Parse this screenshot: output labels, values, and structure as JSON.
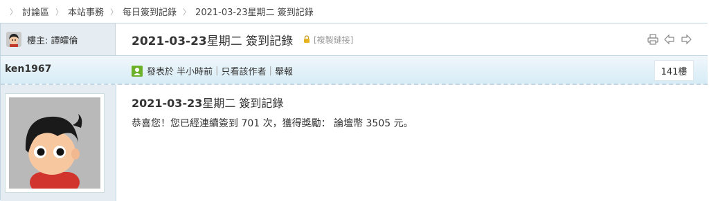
{
  "breadcrumb": {
    "items": [
      "討論區",
      "本站事務",
      "每日簽到記錄",
      "2021-03-23星期二 簽到記錄"
    ]
  },
  "thread": {
    "op_label": "樓主: 譚皬倫",
    "title_date": "2021-03-23",
    "title_rest": "星期二 簽到記錄",
    "copy_link": "[複製鏈接]"
  },
  "post": {
    "username": "ken1967",
    "posted_at": "發表於 半小時前",
    "only_author": "只看該作者",
    "report": "舉報",
    "floor": "141樓",
    "title_date": "2021-03-23",
    "title_rest": "星期二 簽到記錄",
    "body": "恭喜您！您已經連續簽到 701 次，獲得獎勵： 論壇幣 3505 元。"
  },
  "icons": {
    "print": "print-icon",
    "prev": "prev-thread-icon",
    "next": "next-thread-icon",
    "lock": "lock-icon",
    "meta": "user-online-icon"
  },
  "colors": {
    "border": "#c2d5e3",
    "side_bg": "#e5edf2",
    "header_gradient_bottom": "#d7ecf6"
  }
}
